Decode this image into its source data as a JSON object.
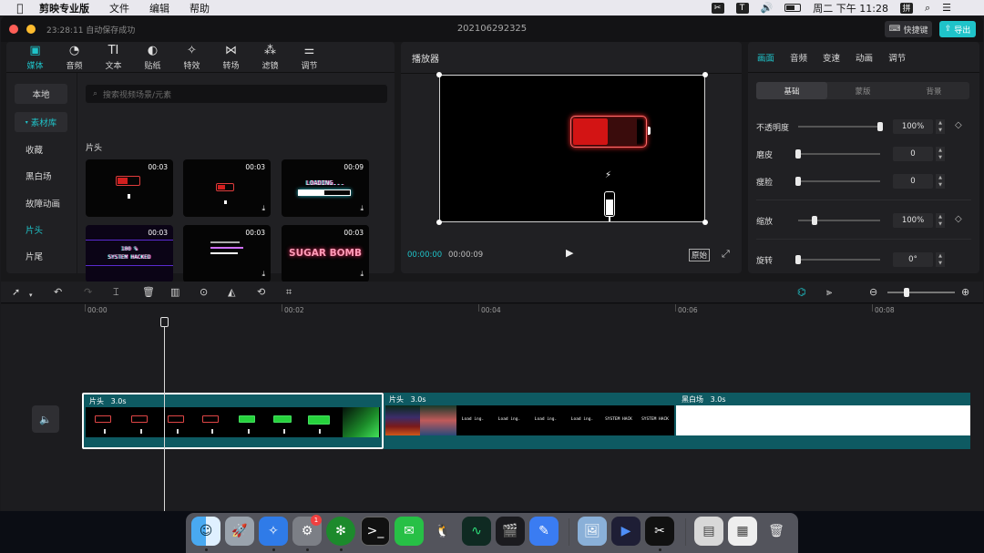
{
  "menubar": {
    "app_name": "剪映专业版",
    "menus": [
      "文件",
      "编辑",
      "帮助"
    ],
    "input_method": "拼",
    "clock": "周二 下午 11:28"
  },
  "window": {
    "autosave": "23:28:11 自动保存成功",
    "project_title": "202106292325",
    "shortcut_label": "快捷键",
    "export_label": "导出",
    "traffic_lights": {
      "close": "#ff5f57",
      "minimize": "#febc2e"
    }
  },
  "media": {
    "tabs": [
      {
        "label": "媒体",
        "icon": "media-icon"
      },
      {
        "label": "音频",
        "icon": "audio-icon"
      },
      {
        "label": "文本",
        "icon": "text-icon"
      },
      {
        "label": "贴纸",
        "icon": "sticker-icon"
      },
      {
        "label": "特效",
        "icon": "effects-icon"
      },
      {
        "label": "转场",
        "icon": "transition-icon"
      },
      {
        "label": "滤镜",
        "icon": "filter-icon"
      },
      {
        "label": "调节",
        "icon": "adjust-icon"
      }
    ],
    "side": [
      "本地",
      "素材库",
      "收藏",
      "黑白场",
      "故障动画",
      "片头",
      "片尾"
    ],
    "search_placeholder": "搜索视频场景/元素",
    "section_label": "片头",
    "thumbs": [
      {
        "duration": "00:03",
        "kind": "battery-low"
      },
      {
        "duration": "00:03",
        "kind": "battery-small"
      },
      {
        "duration": "00:09",
        "kind": "loading",
        "text": "LOADING..."
      },
      {
        "duration": "00:03",
        "kind": "glitch",
        "text": "100 %\nSYSTEM HACKED"
      },
      {
        "duration": "00:03",
        "kind": "glitch-lines"
      },
      {
        "duration": "00:03",
        "kind": "sugar",
        "text": "SUGAR BOMB"
      }
    ]
  },
  "player": {
    "title": "播放器",
    "current_time": "00:00:00",
    "total_time": "00:00:09",
    "original_label": "原始"
  },
  "props": {
    "tabs": [
      "画面",
      "音频",
      "变速",
      "动画",
      "调节"
    ],
    "subtabs": [
      "基础",
      "蒙版",
      "背景"
    ],
    "rows": [
      {
        "label": "不透明度",
        "value": "100%",
        "level": 1.0,
        "keyframe": true
      },
      {
        "label": "磨皮",
        "value": "0",
        "level": 0.0,
        "keyframe": false
      },
      {
        "label": "瘦脸",
        "value": "0",
        "level": 0.0,
        "keyframe": false
      },
      {
        "label": "缩放",
        "value": "100%",
        "level": 0.18,
        "keyframe": true
      },
      {
        "label": "旋转",
        "value": "0°",
        "level": 0.0,
        "keyframe": false
      }
    ]
  },
  "timeline": {
    "ruler": [
      "00:00",
      "00:02",
      "00:04",
      "00:06",
      "00:08"
    ],
    "clips": [
      {
        "label": "片头",
        "duration": "3.0s"
      },
      {
        "label": "片头",
        "duration": "3.0s"
      },
      {
        "label": "黑白场",
        "duration": "3.0s"
      }
    ]
  },
  "colors": {
    "accent": "#1fc3c9",
    "clip_bg": "#0e5a62"
  }
}
